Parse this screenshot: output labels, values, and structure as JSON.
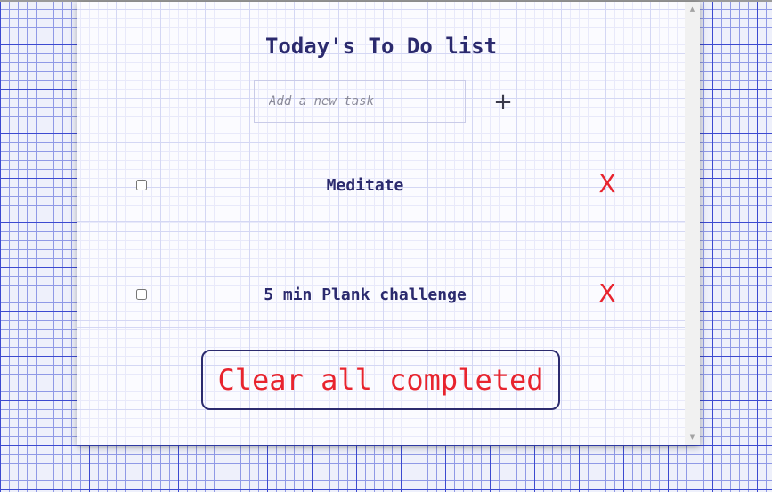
{
  "app": {
    "title": "Today's To Do list"
  },
  "input": {
    "placeholder": "Add a new task",
    "value": ""
  },
  "add_button": {
    "label": "+"
  },
  "tasks": [
    {
      "text": "Meditate",
      "completed": false,
      "delete_label": "X"
    },
    {
      "text": "5 min Plank challenge",
      "completed": false,
      "delete_label": "X"
    }
  ],
  "clear_button": {
    "label": "Clear all completed"
  },
  "colors": {
    "title": "#2b2a6e",
    "delete": "#e8242e",
    "clear_text": "#e8242e",
    "clear_border": "#2b2a6e",
    "page_grid": "#3c4ad0"
  },
  "icons": {
    "add": "plus-icon",
    "delete": "x-icon",
    "scroll_up": "triangle-up-icon",
    "scroll_down": "triangle-down-icon"
  }
}
